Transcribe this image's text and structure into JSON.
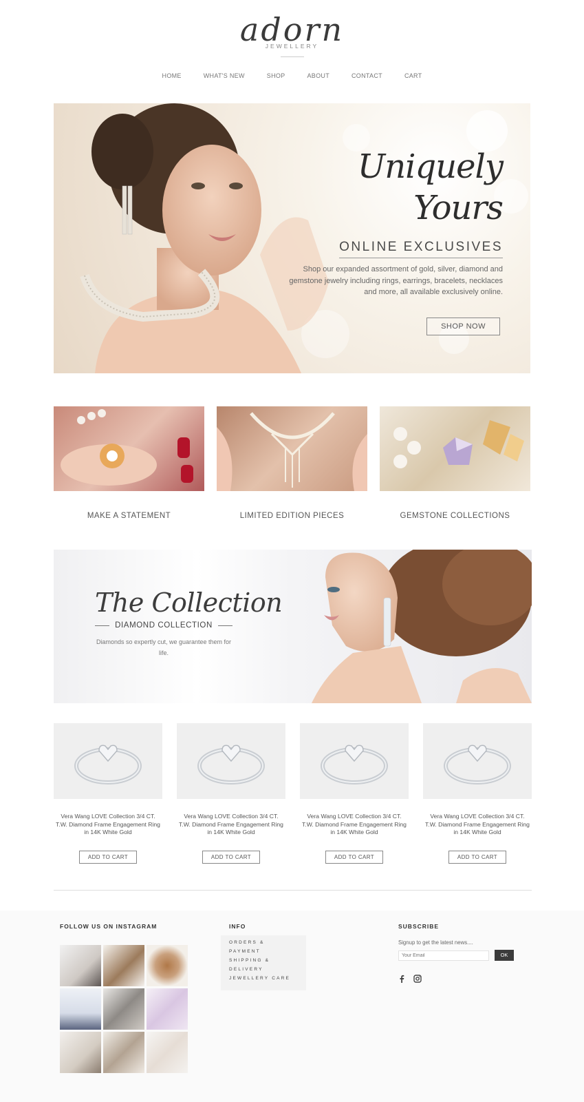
{
  "brand": {
    "logo_text": "adorn",
    "logo_sub": "JEWELLERY"
  },
  "nav": {
    "items": [
      "HOME",
      "WHAT'S NEW",
      "SHOP",
      "ABOUT",
      "CONTACT",
      "CART"
    ]
  },
  "hero": {
    "script_title": "Uniquely Yours",
    "title": "ONLINE EXCLUSIVES",
    "description": "Shop our expanded assortment of gold, silver, diamond and gemstone jewelry including rings, earrings, bracelets, necklaces and more, all available exclusively online.",
    "button": "SHOP NOW"
  },
  "categories": [
    {
      "label": "MAKE A STATEMENT"
    },
    {
      "label": "LIMITED EDITION PIECES"
    },
    {
      "label": "GEMSTONE COLLECTIONS"
    }
  ],
  "collection": {
    "script_title": "The Collection",
    "subtitle": "DIAMOND COLLECTION",
    "description": "Diamonds so expertly cut, we guarantee them for life."
  },
  "products": [
    {
      "name": "Vera Wang LOVE Collection 3/4 CT. T.W. Diamond Frame Engagement Ring in 14K White Gold",
      "button": "ADD TO CART"
    },
    {
      "name": "Vera Wang LOVE Collection 3/4 CT. T.W. Diamond Frame Engagement Ring in 14K White Gold",
      "button": "ADD TO CART"
    },
    {
      "name": "Vera Wang LOVE Collection 3/4 CT. T.W. Diamond Frame Engagement Ring in 14K White Gold",
      "button": "ADD TO CART"
    },
    {
      "name": "Vera Wang LOVE Collection 3/4 CT. T.W. Diamond Frame Engagement Ring in 14K White Gold",
      "button": "ADD TO CART"
    }
  ],
  "footer": {
    "instagram_heading": "FOLLOW US ON INSTAGRAM",
    "info_heading": "INFO",
    "info_links": [
      "ORDERS & PAYMENT",
      "SHIPPING & DELIVERY",
      "JEWELLERY CARE"
    ],
    "subscribe_heading": "SUBSCRIBE",
    "subscribe_text": "Signup to get the latest news....",
    "email_placeholder": "Your Email",
    "ok_button": "OK",
    "social": [
      "facebook-icon",
      "instagram-icon"
    ]
  },
  "colors": {
    "accent_dark": "#3b3b3b",
    "text": "#555555",
    "hero_bg": "#f4ede2"
  }
}
